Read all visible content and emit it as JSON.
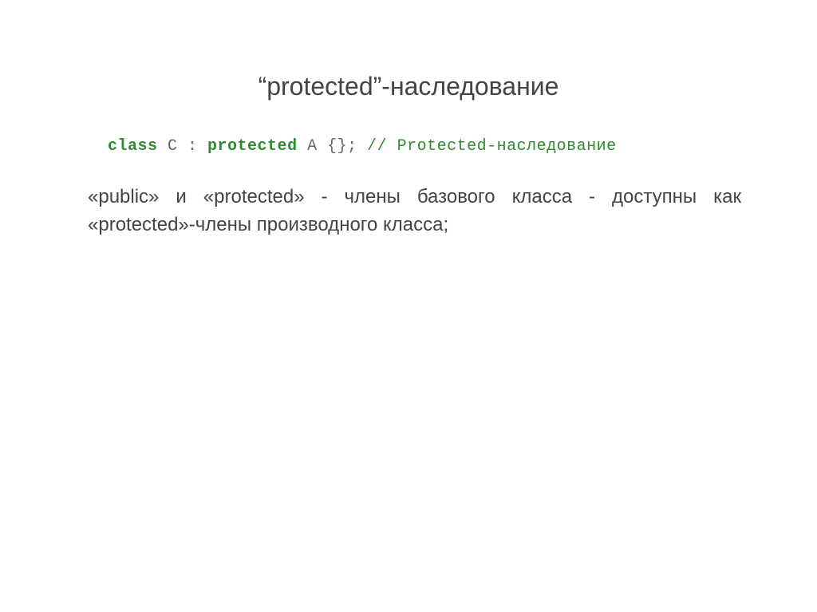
{
  "title": "“protected”-наследование",
  "code": {
    "class_kw": "class",
    "class_name": " C ",
    "colon": ": ",
    "protected_kw": "protected",
    "base": " A ",
    "braces": "{}; ",
    "comment": "// Protected-наследование"
  },
  "body": "«public» и «protected» - члены базового класса - доступны как «protected»-члены производного класса;"
}
